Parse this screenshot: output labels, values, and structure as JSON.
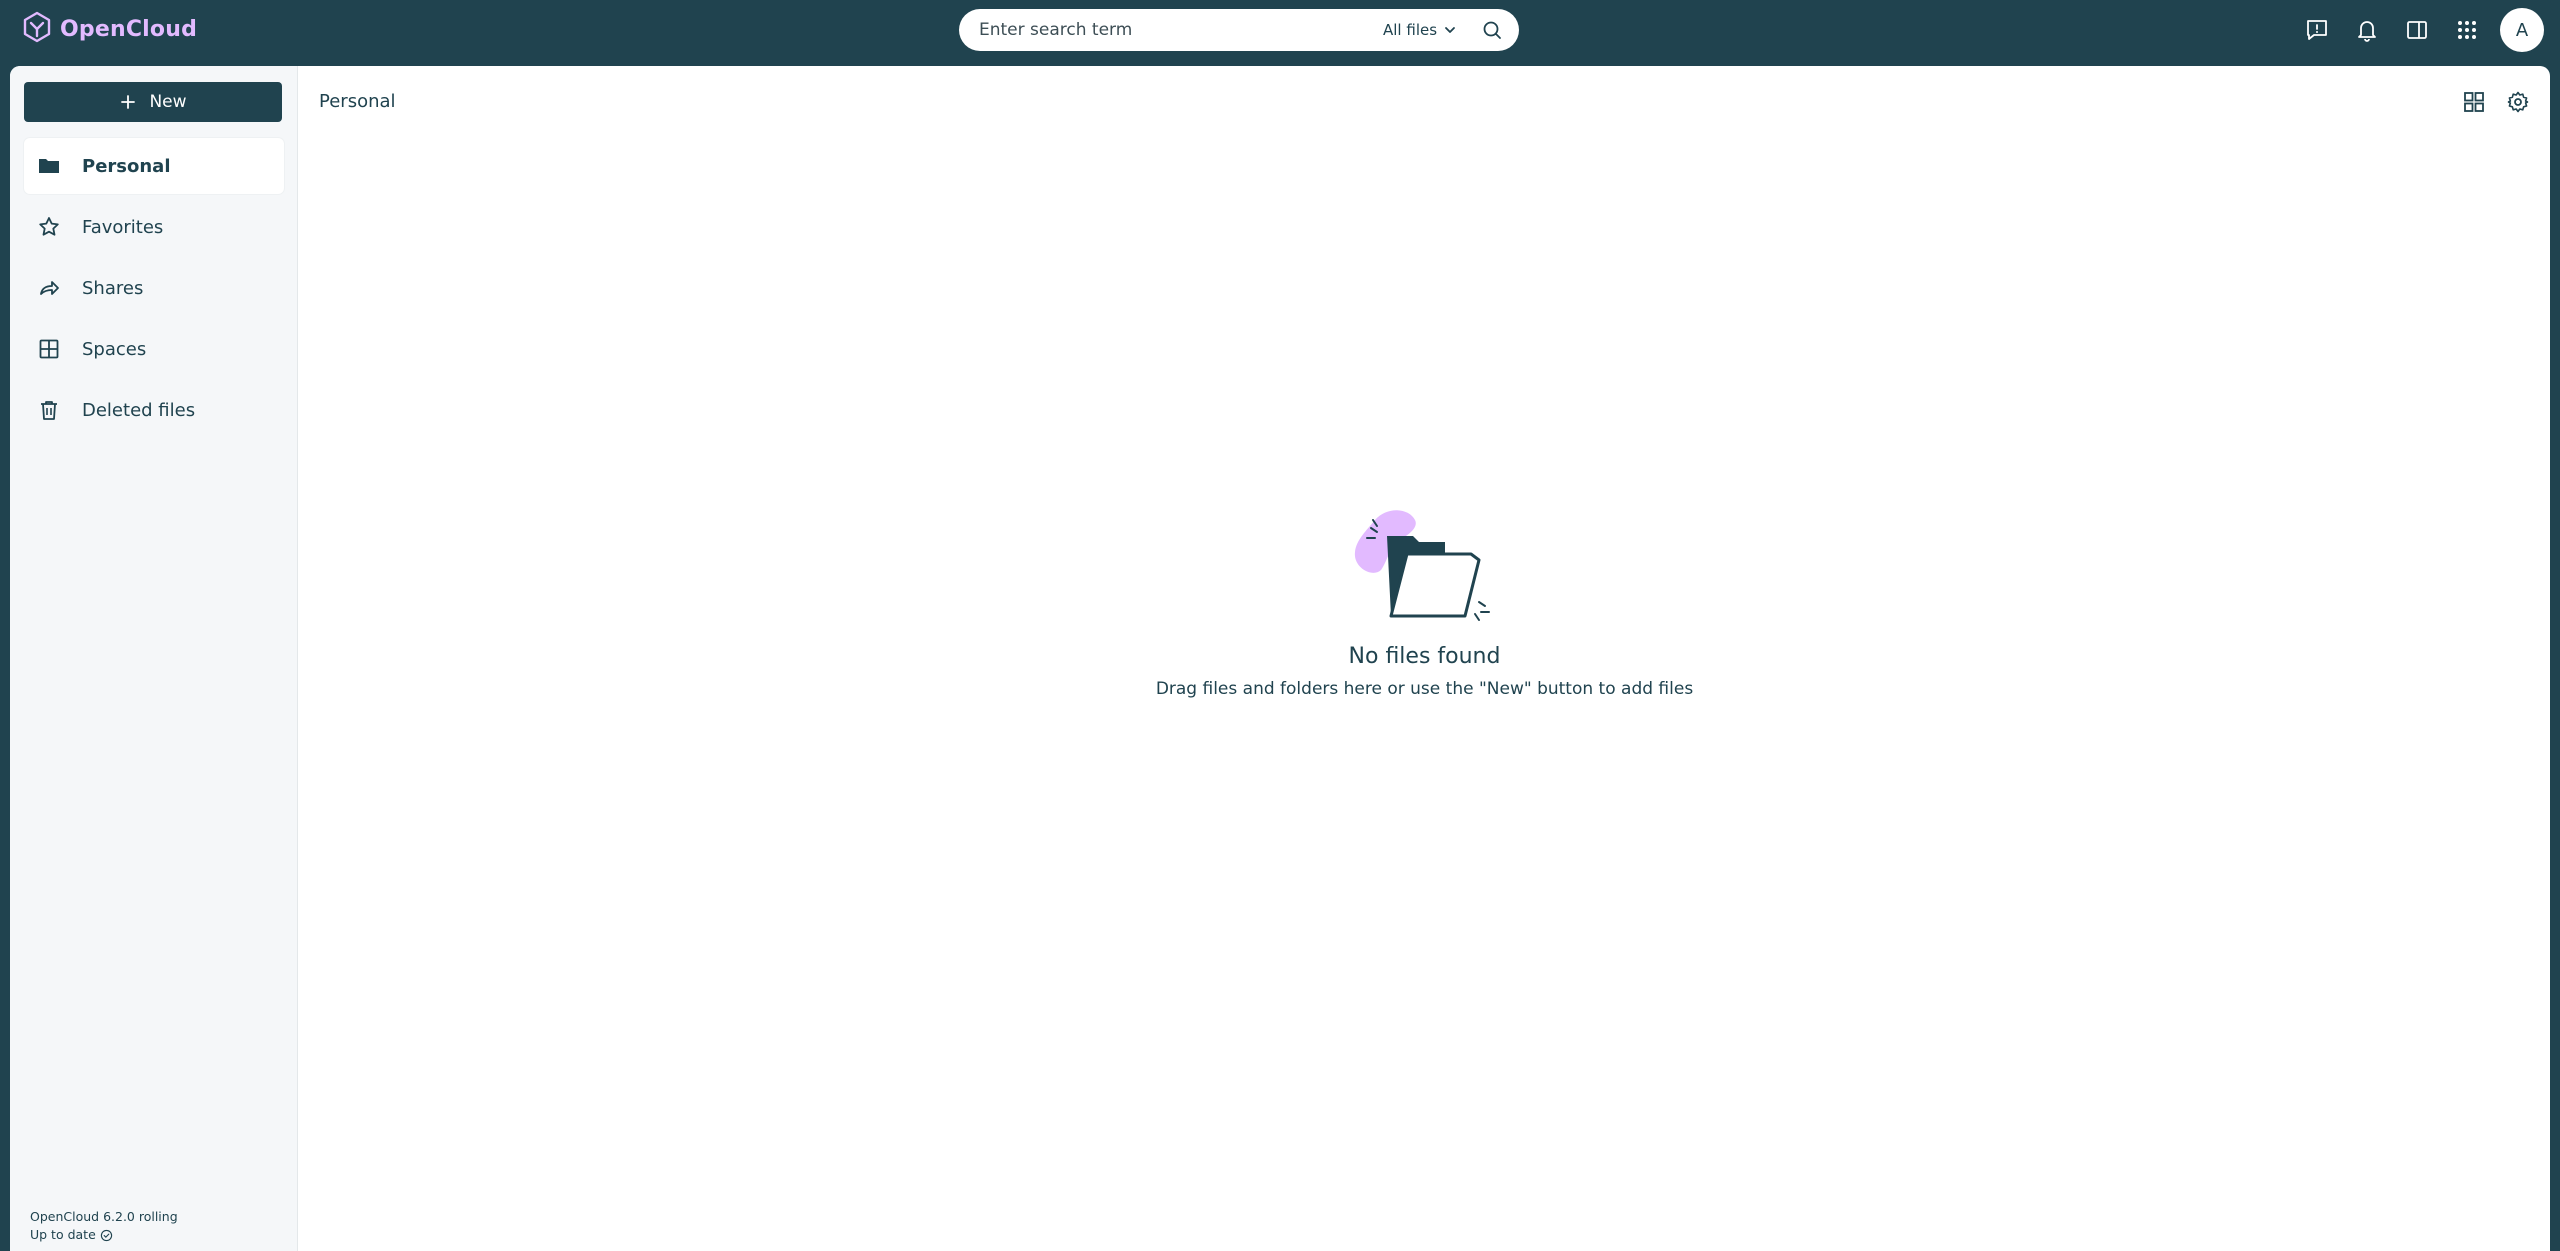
{
  "brand": {
    "name": "OpenCloud"
  },
  "search": {
    "placeholder": "Enter search term",
    "scope": "All files"
  },
  "user": {
    "initial": "A"
  },
  "sidebar": {
    "new_label": "New",
    "items": [
      {
        "label": "Personal",
        "icon": "folder-icon",
        "active": true
      },
      {
        "label": "Favorites",
        "icon": "star-icon"
      },
      {
        "label": "Shares",
        "icon": "share-icon"
      },
      {
        "label": "Spaces",
        "icon": "grid-icon"
      },
      {
        "label": "Deleted files",
        "icon": "trash-icon"
      }
    ],
    "version": "OpenCloud 6.2.0 rolling",
    "status": "Up to date"
  },
  "main": {
    "breadcrumb": "Personal",
    "empty_title": "No files found",
    "empty_text": "Drag files and folders here or use the \"New\" button to add files"
  },
  "colors": {
    "primary": "#20434f",
    "accent": "#e2baff",
    "sidebar": "#f5f7f9"
  }
}
